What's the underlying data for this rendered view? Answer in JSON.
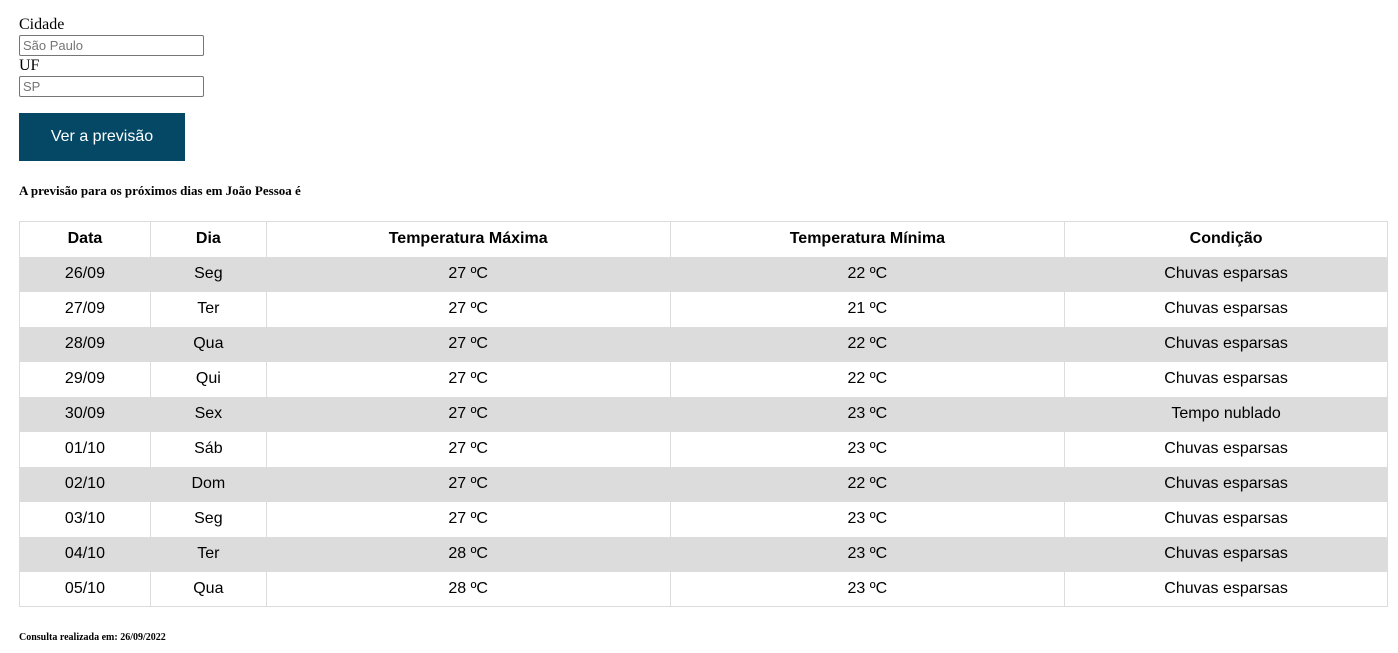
{
  "form": {
    "city_label": "Cidade",
    "city_placeholder": "São Paulo",
    "city_value": "",
    "uf_label": "UF",
    "uf_placeholder": "SP",
    "uf_value": "",
    "submit_label": "Ver a previsão"
  },
  "result": {
    "heading": "A previsão para os próximos dias em João Pessoa é"
  },
  "table": {
    "headers": [
      "Data",
      "Dia",
      "Temperatura Máxima",
      "Temperatura Mínima",
      "Condição"
    ],
    "rows": [
      {
        "data": "26/09",
        "dia": "Seg",
        "max": "27 ºC",
        "min": "22 ºC",
        "condicao": "Chuvas esparsas"
      },
      {
        "data": "27/09",
        "dia": "Ter",
        "max": "27 ºC",
        "min": "21 ºC",
        "condicao": "Chuvas esparsas"
      },
      {
        "data": "28/09",
        "dia": "Qua",
        "max": "27 ºC",
        "min": "22 ºC",
        "condicao": "Chuvas esparsas"
      },
      {
        "data": "29/09",
        "dia": "Qui",
        "max": "27 ºC",
        "min": "22 ºC",
        "condicao": "Chuvas esparsas"
      },
      {
        "data": "30/09",
        "dia": "Sex",
        "max": "27 ºC",
        "min": "23 ºC",
        "condicao": "Tempo nublado"
      },
      {
        "data": "01/10",
        "dia": "Sáb",
        "max": "27 ºC",
        "min": "23 ºC",
        "condicao": "Chuvas esparsas"
      },
      {
        "data": "02/10",
        "dia": "Dom",
        "max": "27 ºC",
        "min": "22 ºC",
        "condicao": "Chuvas esparsas"
      },
      {
        "data": "03/10",
        "dia": "Seg",
        "max": "27 ºC",
        "min": "23 ºC",
        "condicao": "Chuvas esparsas"
      },
      {
        "data": "04/10",
        "dia": "Ter",
        "max": "28 ºC",
        "min": "23 ºC",
        "condicao": "Chuvas esparsas"
      },
      {
        "data": "05/10",
        "dia": "Qua",
        "max": "28 ºC",
        "min": "23 ºC",
        "condicao": "Chuvas esparsas"
      }
    ]
  },
  "footer": {
    "note": "Consulta realizada em: 26/09/2022"
  },
  "colors": {
    "button_bg": "#044865",
    "button_text": "#ffffff",
    "row_stripe": "#dcdcdc"
  }
}
